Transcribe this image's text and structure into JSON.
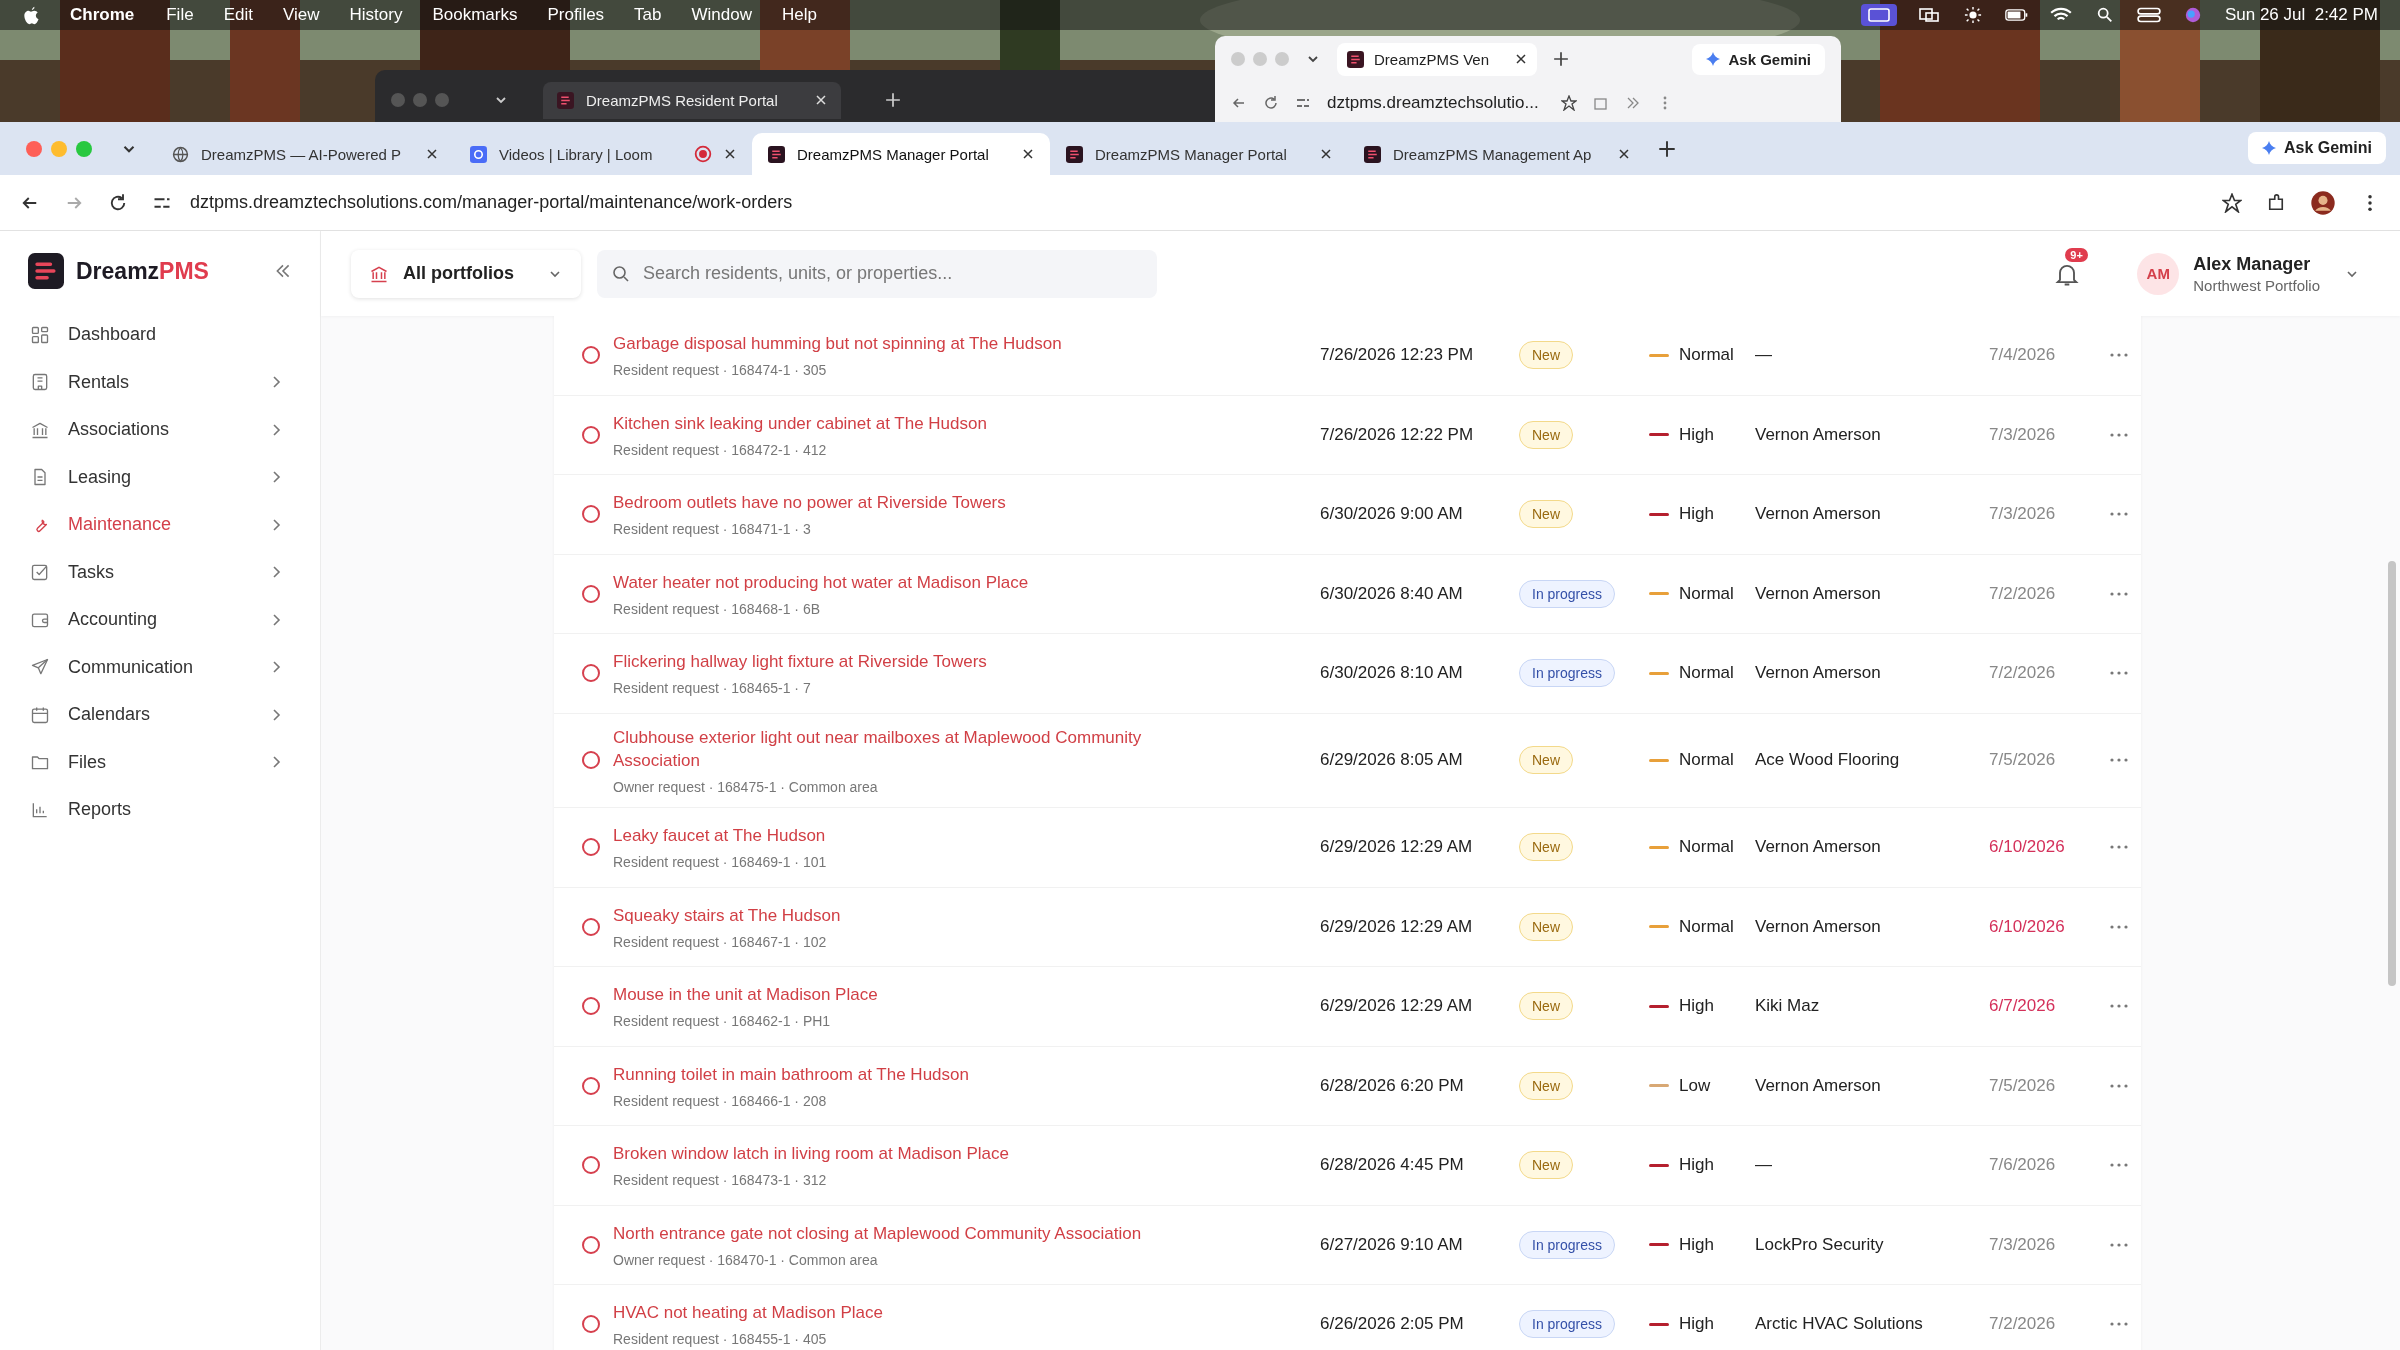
{
  "menu_bar": {
    "app": "Chrome",
    "items": [
      "File",
      "Edit",
      "View",
      "History",
      "Bookmarks",
      "Profiles",
      "Tab",
      "Window",
      "Help"
    ],
    "clock": "Sun 26 Jul  2:42 PM"
  },
  "background_windows": [
    {
      "tab": "DreamzPMS Resident Portal"
    },
    {
      "tab": "DreamzPMS Ven",
      "ask": "Ask Gemini",
      "url": "dztpms.dreamztechsolutio..."
    }
  ],
  "browser": {
    "tabs": [
      {
        "title": "DreamzPMS — AI-Powered P",
        "selected": false,
        "recording": false
      },
      {
        "title": "Videos | Library | Loom",
        "selected": false,
        "recording": true
      },
      {
        "title": "DreamzPMS Manager Portal",
        "selected": true,
        "recording": false
      },
      {
        "title": "DreamzPMS Manager Portal",
        "selected": false,
        "recording": false
      },
      {
        "title": "DreamzPMS Management Ap",
        "selected": false,
        "recording": false
      }
    ],
    "ask_gemini": "Ask Gemini",
    "url": "dztpms.dreamztechsolutions.com/manager-portal/maintenance/work-orders"
  },
  "logo": {
    "part_1": "Dreamz",
    "part_2": "PMS"
  },
  "header": {
    "portfolio": "All portfolios",
    "search": {
      "placeholder": "Search residents, units, or properties..."
    },
    "notification_badge": "9+",
    "user": {
      "initials": "AM",
      "name": "Alex Manager",
      "subtitle": "Northwest Portfolio"
    }
  },
  "sidebar": {
    "items": [
      {
        "label": "Dashboard",
        "selected": false,
        "expandable": false
      },
      {
        "label": "Rentals",
        "selected": false,
        "expandable": true
      },
      {
        "label": "Associations",
        "selected": false,
        "expandable": true
      },
      {
        "label": "Leasing",
        "selected": false,
        "expandable": true
      },
      {
        "label": "Maintenance",
        "selected": true,
        "expandable": true
      },
      {
        "label": "Tasks",
        "selected": false,
        "expandable": true
      },
      {
        "label": "Accounting",
        "selected": false,
        "expandable": true
      },
      {
        "label": "Communication",
        "selected": false,
        "expandable": true
      },
      {
        "label": "Calendars",
        "selected": false,
        "expandable": true
      },
      {
        "label": "Files",
        "selected": false,
        "expandable": true
      },
      {
        "label": "Reports",
        "selected": false,
        "expandable": false
      }
    ]
  },
  "work_orders": [
    {
      "checked": false,
      "title": "Garbage disposal humming but not spinning at The Hudson",
      "details": "Resident request · 168474-1 · 305",
      "created": "7/26/2026 12:23 PM",
      "status": {
        "label": "New",
        "kind": "new"
      },
      "priority": {
        "label": "Normal",
        "kind": "normal"
      },
      "assignee": "—",
      "due": "7/4/2026",
      "overdue": false
    },
    {
      "checked": false,
      "title": "Kitchen sink leaking under cabinet at The Hudson",
      "details": "Resident request · 168472-1 · 412",
      "created": "7/26/2026 12:22 PM",
      "status": {
        "label": "New",
        "kind": "new"
      },
      "priority": {
        "label": "High",
        "kind": "high"
      },
      "assignee": "Vernon Amerson",
      "due": "7/3/2026",
      "overdue": false
    },
    {
      "checked": false,
      "title": "Bedroom outlets have no power at Riverside Towers",
      "details": "Resident request · 168471-1 · 3",
      "created": "6/30/2026 9:00 AM",
      "status": {
        "label": "New",
        "kind": "new"
      },
      "priority": {
        "label": "High",
        "kind": "high"
      },
      "assignee": "Vernon Amerson",
      "due": "7/3/2026",
      "overdue": false
    },
    {
      "checked": false,
      "title": "Water heater not producing hot water at Madison Place",
      "details": "Resident request · 168468-1 · 6B",
      "created": "6/30/2026 8:40 AM",
      "status": {
        "label": "In progress",
        "kind": "in_progress"
      },
      "priority": {
        "label": "Normal",
        "kind": "normal"
      },
      "assignee": "Vernon Amerson",
      "due": "7/2/2026",
      "overdue": false
    },
    {
      "checked": false,
      "title": "Flickering hallway light fixture at Riverside Towers",
      "details": "Resident request · 168465-1 · 7",
      "created": "6/30/2026 8:10 AM",
      "status": {
        "label": "In progress",
        "kind": "in_progress"
      },
      "priority": {
        "label": "Normal",
        "kind": "normal"
      },
      "assignee": "Vernon Amerson",
      "due": "7/2/2026",
      "overdue": false
    },
    {
      "checked": false,
      "title": "Clubhouse exterior light out near mailboxes at Maplewood Community Association",
      "details": "Owner request · 168475-1 · Common area",
      "created": "6/29/2026 8:05 AM",
      "status": {
        "label": "New",
        "kind": "new"
      },
      "priority": {
        "label": "Normal",
        "kind": "normal"
      },
      "assignee": "Ace Wood Flooring",
      "due": "7/5/2026",
      "overdue": false
    },
    {
      "checked": false,
      "title": "Leaky faucet at The Hudson",
      "details": "Resident request · 168469-1 · 101",
      "created": "6/29/2026 12:29 AM",
      "status": {
        "label": "New",
        "kind": "new"
      },
      "priority": {
        "label": "Normal",
        "kind": "normal"
      },
      "assignee": "Vernon Amerson",
      "due": "6/10/2026",
      "overdue": true
    },
    {
      "checked": false,
      "title": "Squeaky stairs at The Hudson",
      "details": "Resident request · 168467-1 · 102",
      "created": "6/29/2026 12:29 AM",
      "status": {
        "label": "New",
        "kind": "new"
      },
      "priority": {
        "label": "Normal",
        "kind": "normal"
      },
      "assignee": "Vernon Amerson",
      "due": "6/10/2026",
      "overdue": true
    },
    {
      "checked": false,
      "title": "Mouse in the unit at Madison Place",
      "details": "Resident request · 168462-1 · PH1",
      "created": "6/29/2026 12:29 AM",
      "status": {
        "label": "New",
        "kind": "new"
      },
      "priority": {
        "label": "High",
        "kind": "high"
      },
      "assignee": "Kiki Maz",
      "due": "6/7/2026",
      "overdue": true
    },
    {
      "checked": false,
      "title": "Running toilet in main bathroom at The Hudson",
      "details": "Resident request · 168466-1 · 208",
      "created": "6/28/2026 6:20 PM",
      "status": {
        "label": "New",
        "kind": "new"
      },
      "priority": {
        "label": "Low",
        "kind": "low"
      },
      "assignee": "Vernon Amerson",
      "due": "7/5/2026",
      "overdue": false
    },
    {
      "checked": false,
      "title": "Broken window latch in living room at Madison Place",
      "details": "Resident request · 168473-1 · 312",
      "created": "6/28/2026 4:45 PM",
      "status": {
        "label": "New",
        "kind": "new"
      },
      "priority": {
        "label": "High",
        "kind": "high"
      },
      "assignee": "—",
      "due": "7/6/2026",
      "overdue": false
    },
    {
      "checked": false,
      "title": "North entrance gate not closing at Maplewood Community Association",
      "details": "Owner request · 168470-1 · Common area",
      "created": "6/27/2026 9:10 AM",
      "status": {
        "label": "In progress",
        "kind": "in_progress"
      },
      "priority": {
        "label": "High",
        "kind": "high"
      },
      "assignee": "LockPro Security",
      "due": "7/3/2026",
      "overdue": false
    },
    {
      "checked": false,
      "title": "HVAC not heating at Madison Place",
      "details": "Resident request · 168455-1 · 405",
      "created": "6/26/2026 2:05 PM",
      "status": {
        "label": "In progress",
        "kind": "in_progress"
      },
      "priority": {
        "label": "High",
        "kind": "high"
      },
      "assignee": "Arctic HVAC Solutions",
      "due": "7/2/2026",
      "overdue": false
    }
  ]
}
